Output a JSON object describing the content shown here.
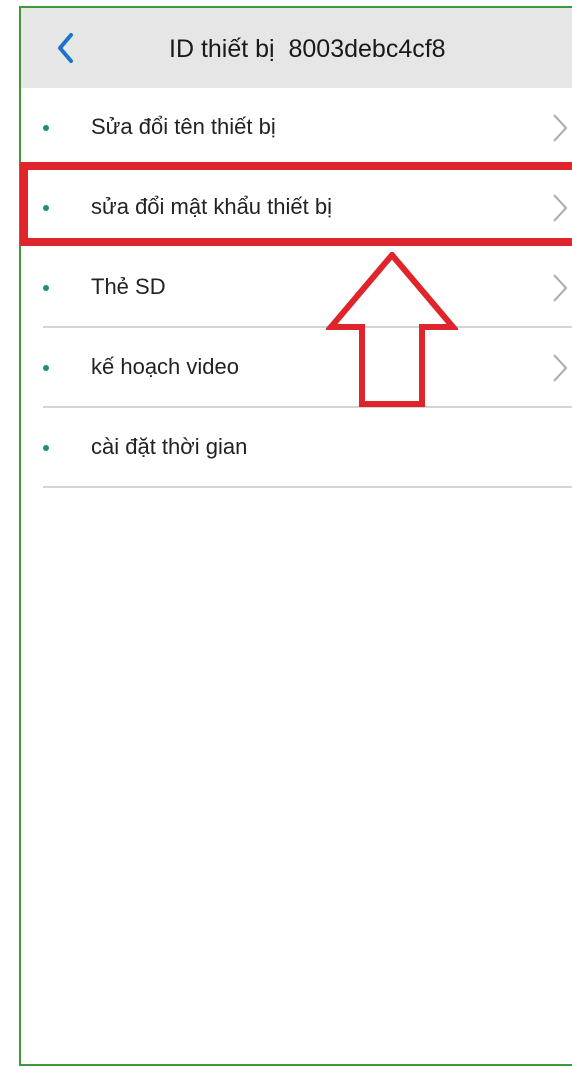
{
  "header": {
    "back_icon": "chevron-left-icon",
    "title": "ID thiết bị  8003debc4cf8"
  },
  "menu": {
    "items": [
      {
        "label": "Sửa đổi tên thiết bị",
        "has_chevron": true
      },
      {
        "label": "sửa đổi mật khẩu thiết bị",
        "has_chevron": true
      },
      {
        "label": "Thẻ SD",
        "has_chevron": true
      },
      {
        "label": "kế hoạch video",
        "has_chevron": true
      },
      {
        "label": "cài đặt thời gian",
        "has_chevron": false
      }
    ]
  },
  "annotation": {
    "highlight_color": "#e0242b",
    "highlighted_item": "sửa đổi mật khẩu thiết bị"
  },
  "colors": {
    "accent": "#1e73c8",
    "bullet": "#1e8f7a",
    "header_bg": "#e6e6e6",
    "frame_border": "#3c9a3c"
  }
}
